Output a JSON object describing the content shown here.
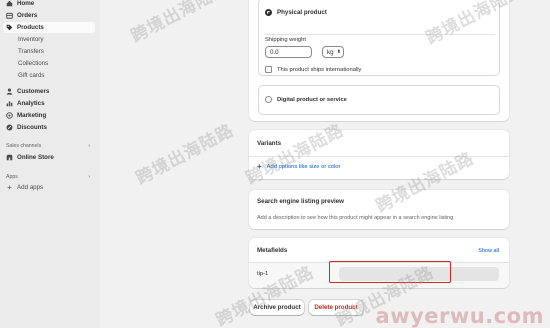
{
  "sidebar": {
    "items": [
      {
        "label": "Home",
        "icon": "home-icon"
      },
      {
        "label": "Orders",
        "icon": "orders-icon"
      },
      {
        "label": "Products",
        "icon": "tag-icon"
      },
      {
        "label": "Inventory"
      },
      {
        "label": "Transfers"
      },
      {
        "label": "Collections"
      },
      {
        "label": "Gift cards"
      },
      {
        "label": "Customers",
        "icon": "person-icon"
      },
      {
        "label": "Analytics",
        "icon": "chart-icon"
      },
      {
        "label": "Marketing",
        "icon": "target-icon"
      },
      {
        "label": "Discounts",
        "icon": "discount-icon"
      }
    ],
    "sales_channels_label": "Sales channels",
    "online_store_label": "Online Store",
    "apps_label": "Apps",
    "add_apps_label": "Add apps"
  },
  "shipping": {
    "physical_label": "Physical product",
    "weight_label": "Shipping weight",
    "weight_value": "0.0",
    "unit_value": "kg",
    "international_label": "This product ships internationally",
    "digital_label": "Digital product or service"
  },
  "variants": {
    "title": "Variants",
    "add_label": "Add options like size or color"
  },
  "seo": {
    "title": "Search engine listing preview",
    "description": "Add a description to see how this product might appear in a search engine listing"
  },
  "metafields": {
    "title": "Metafields",
    "show_all": "Show all",
    "row_label": "tip-1",
    "row_value": ""
  },
  "footer": {
    "archive_label": "Archive product",
    "delete_label": "Delete product"
  },
  "watermark": {
    "text": "跨境出海陆路",
    "site": "awyerwu.com"
  },
  "colors": {
    "sidebar_bg": "#ebebeb",
    "page_bg": "#f1f1f1",
    "delete_red": "#c4291c",
    "highlight_red": "#d2271e",
    "link_blue": "#005bd3"
  }
}
